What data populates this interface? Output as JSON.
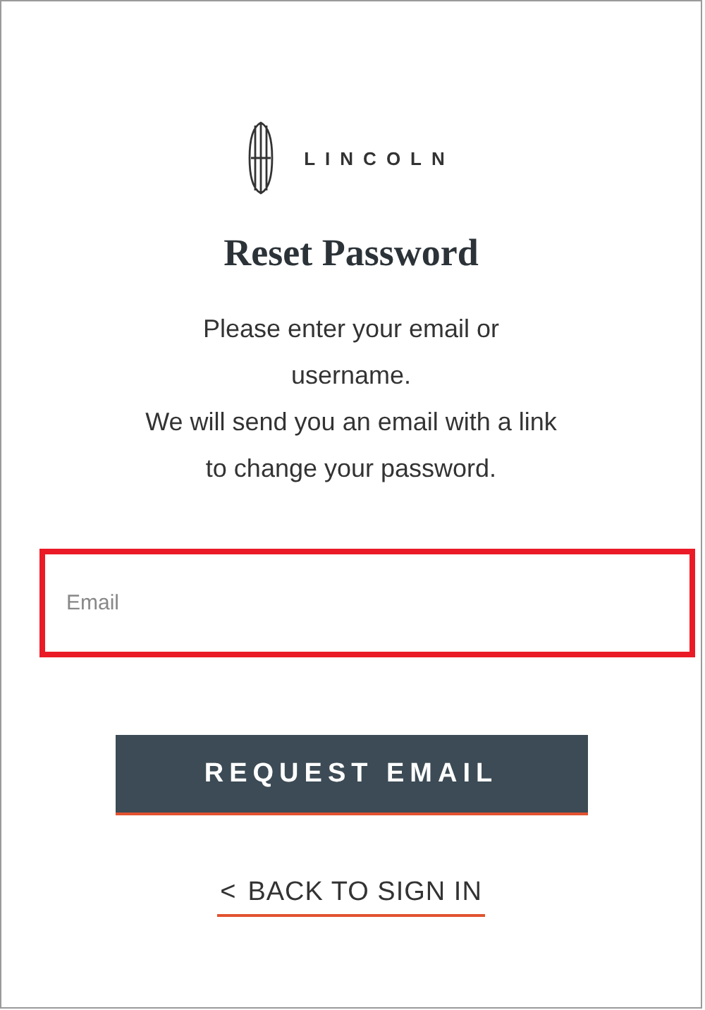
{
  "brand": {
    "name": "LINCOLN"
  },
  "title": "Reset Password",
  "instructions": [
    "Please enter your email or",
    "username.",
    "We will send you an email with a link",
    "to change your password."
  ],
  "email_field": {
    "placeholder": "Email",
    "highlighted": true
  },
  "submit_button": {
    "label": "REQUEST EMAIL"
  },
  "back_link": {
    "icon": "<",
    "label": "BACK TO SIGN IN"
  }
}
